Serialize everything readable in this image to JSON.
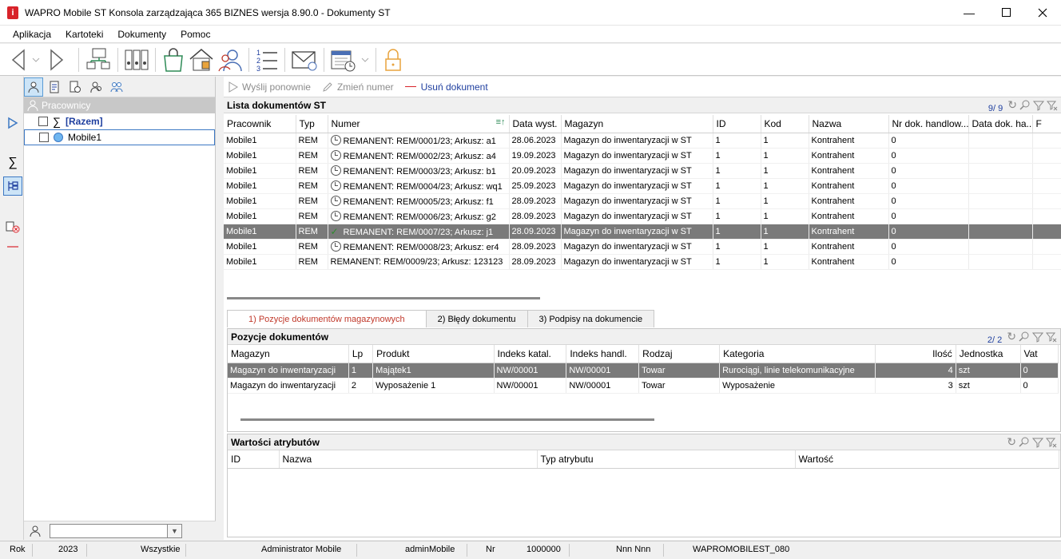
{
  "window": {
    "title": "WAPRO Mobile ST Konsola zarządzająca 365 BIZNES wersja 8.90.0 - Dokumenty ST",
    "app_icon": "i"
  },
  "menu": [
    "Aplikacja",
    "Kartoteki",
    "Dokumenty",
    "Pomoc"
  ],
  "toolbar": {
    "icons": [
      "back-icon",
      "forward-icon",
      "network-icon",
      "binders-icon",
      "shopping-bag-icon",
      "home-icon",
      "users-icon",
      "numbered-list-icon",
      "mail-icon",
      "calendar-icon",
      "lock-icon"
    ]
  },
  "left_panel": {
    "header": "Pracownicy",
    "tree": [
      {
        "label": "[Razem]",
        "icon": "sum-icon"
      },
      {
        "label": "Mobile1",
        "icon": "circle-icon"
      }
    ]
  },
  "actions": {
    "resend": "Wyślij ponownie",
    "rename": "Zmień numer",
    "delete": "Usuń dokument"
  },
  "documents": {
    "title": "Lista dokumentów ST",
    "count": "9/ 9",
    "columns": [
      "Pracownik",
      "Typ",
      "Numer",
      "Data wyst.",
      "Magazyn",
      "ID",
      "Kod",
      "Nazwa",
      "Nr dok. handlow...",
      "Data dok. ha...",
      "F"
    ],
    "rows": [
      {
        "pracownik": "Mobile1",
        "typ": "REM",
        "status": "clock",
        "numer": "REMANENT: REM/0001/23; Arkusz: a1",
        "data": "28.06.2023",
        "magazyn": "Magazyn do inwentaryzacji w ST",
        "id": "1",
        "kod": "1",
        "nazwa": "Kontrahent",
        "nr_dok": "0"
      },
      {
        "pracownik": "Mobile1",
        "typ": "REM",
        "status": "clock",
        "numer": "REMANENT: REM/0002/23; Arkusz: a4",
        "data": "19.09.2023",
        "magazyn": "Magazyn do inwentaryzacji w ST",
        "id": "1",
        "kod": "1",
        "nazwa": "Kontrahent",
        "nr_dok": "0"
      },
      {
        "pracownik": "Mobile1",
        "typ": "REM",
        "status": "clock",
        "numer": "REMANENT: REM/0003/23; Arkusz: b1",
        "data": "20.09.2023",
        "magazyn": "Magazyn do inwentaryzacji w ST",
        "id": "1",
        "kod": "1",
        "nazwa": "Kontrahent",
        "nr_dok": "0"
      },
      {
        "pracownik": "Mobile1",
        "typ": "REM",
        "status": "clock",
        "numer": "REMANENT: REM/0004/23; Arkusz: wq1",
        "data": "25.09.2023",
        "magazyn": "Magazyn do inwentaryzacji w ST",
        "id": "1",
        "kod": "1",
        "nazwa": "Kontrahent",
        "nr_dok": "0"
      },
      {
        "pracownik": "Mobile1",
        "typ": "REM",
        "status": "clock",
        "numer": "REMANENT: REM/0005/23; Arkusz: f1",
        "data": "28.09.2023",
        "magazyn": "Magazyn do inwentaryzacji w ST",
        "id": "1",
        "kod": "1",
        "nazwa": "Kontrahent",
        "nr_dok": "0"
      },
      {
        "pracownik": "Mobile1",
        "typ": "REM",
        "status": "clock",
        "numer": "REMANENT: REM/0006/23; Arkusz: g2",
        "data": "28.09.2023",
        "magazyn": "Magazyn do inwentaryzacji w ST",
        "id": "1",
        "kod": "1",
        "nazwa": "Kontrahent",
        "nr_dok": "0"
      },
      {
        "pracownik": "Mobile1",
        "typ": "REM",
        "status": "check",
        "numer": "REMANENT: REM/0007/23; Arkusz: j1",
        "data": "28.09.2023",
        "magazyn": "Magazyn do inwentaryzacji w ST",
        "id": "1",
        "kod": "1",
        "nazwa": "Kontrahent",
        "nr_dok": "0",
        "selected": true
      },
      {
        "pracownik": "Mobile1",
        "typ": "REM",
        "status": "clock",
        "numer": "REMANENT: REM/0008/23; Arkusz: er4",
        "data": "28.09.2023",
        "magazyn": "Magazyn do inwentaryzacji w ST",
        "id": "1",
        "kod": "1",
        "nazwa": "Kontrahent",
        "nr_dok": "0"
      },
      {
        "pracownik": "Mobile1",
        "typ": "REM",
        "status": "none",
        "numer": "REMANENT: REM/0009/23; Arkusz: 123123",
        "data": "28.09.2023",
        "magazyn": "Magazyn do inwentaryzacji w ST",
        "id": "1",
        "kod": "1",
        "nazwa": "Kontrahent",
        "nr_dok": "0"
      }
    ]
  },
  "detail_tabs": [
    "1) Pozycje dokumentów magazynowych",
    "2) Błędy dokumentu",
    "3) Podpisy na dokumencie"
  ],
  "positions": {
    "title": "Pozycje dokumentów",
    "count": "2/ 2",
    "columns": [
      "Magazyn",
      "Lp",
      "Produkt",
      "Indeks katal.",
      "Indeks handl.",
      "Rodzaj",
      "Kategoria",
      "Ilość",
      "Jednostka",
      "Vat"
    ],
    "rows": [
      {
        "magazyn": "Magazyn do inwentaryzacji",
        "lp": "1",
        "produkt": "Majątek1",
        "indeks_katal": "NW/00001",
        "indeks_handl": "NW/00001",
        "rodzaj": "Towar",
        "kategoria": "Rurociągi, linie telekomunikacyjne",
        "ilosc": "4",
        "jednostka": "szt",
        "vat": "0",
        "selected": true
      },
      {
        "magazyn": "Magazyn do inwentaryzacji",
        "lp": "2",
        "produkt": "Wyposażenie 1",
        "indeks_katal": "NW/00001",
        "indeks_handl": "NW/00001",
        "rodzaj": "Towar",
        "kategoria": "Wyposażenie",
        "ilosc": "3",
        "jednostka": "szt",
        "vat": "0"
      }
    ]
  },
  "attributes": {
    "title": "Wartości atrybutów",
    "columns": [
      "ID",
      "Nazwa",
      "Typ atrybutu",
      "Wartość"
    ]
  },
  "status_bar": {
    "rok_label": "Rok",
    "rok_value": "2023",
    "filter": "Wszystkie",
    "user": "Administrator Mobile",
    "login": "adminMobile",
    "nr_label": "Nr",
    "nr_value": "1000000",
    "nnn": "Nnn Nnn",
    "db": "WAPROMOBILEST_080"
  }
}
